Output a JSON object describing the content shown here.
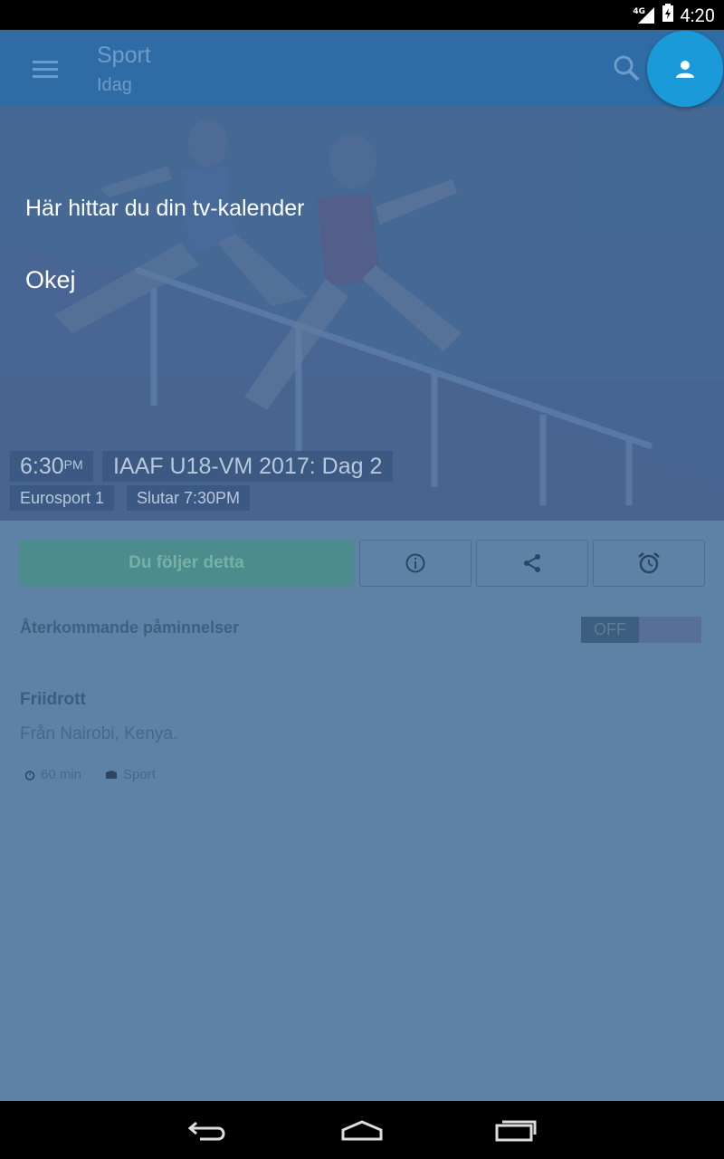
{
  "status_bar": {
    "network": "4G",
    "time": "4:20"
  },
  "toolbar": {
    "title": "Sport",
    "subtitle": "Idag",
    "menu_icon": "menu-icon",
    "search_icon": "search-icon",
    "profile_icon": "person-icon",
    "color": "#2f6ba5",
    "fab_color": "#1a9ad8"
  },
  "tip": {
    "message": "Här hittar du din tv-kalender",
    "ok_label": "Okej"
  },
  "program": {
    "time": "6:30",
    "time_suffix": "PM",
    "title": "IAAF U18-VM 2017: Dag 2",
    "channel": "Eurosport 1",
    "ends": "Slutar 7:30PM"
  },
  "actions": {
    "follow_label": "Du följer detta",
    "info_icon": "info-icon",
    "share_icon": "share-icon",
    "alarm_icon": "alarm-icon"
  },
  "reminders": {
    "label": "Återkommande påminnelser",
    "toggle_state": "OFF"
  },
  "details": {
    "genre": "Friidrott",
    "description": "Från Nairobi, Kenya.",
    "duration": "60 min",
    "category": "Sport"
  },
  "nav": {
    "back_icon": "back-icon",
    "home_icon": "home-icon",
    "recents_icon": "recents-icon"
  }
}
